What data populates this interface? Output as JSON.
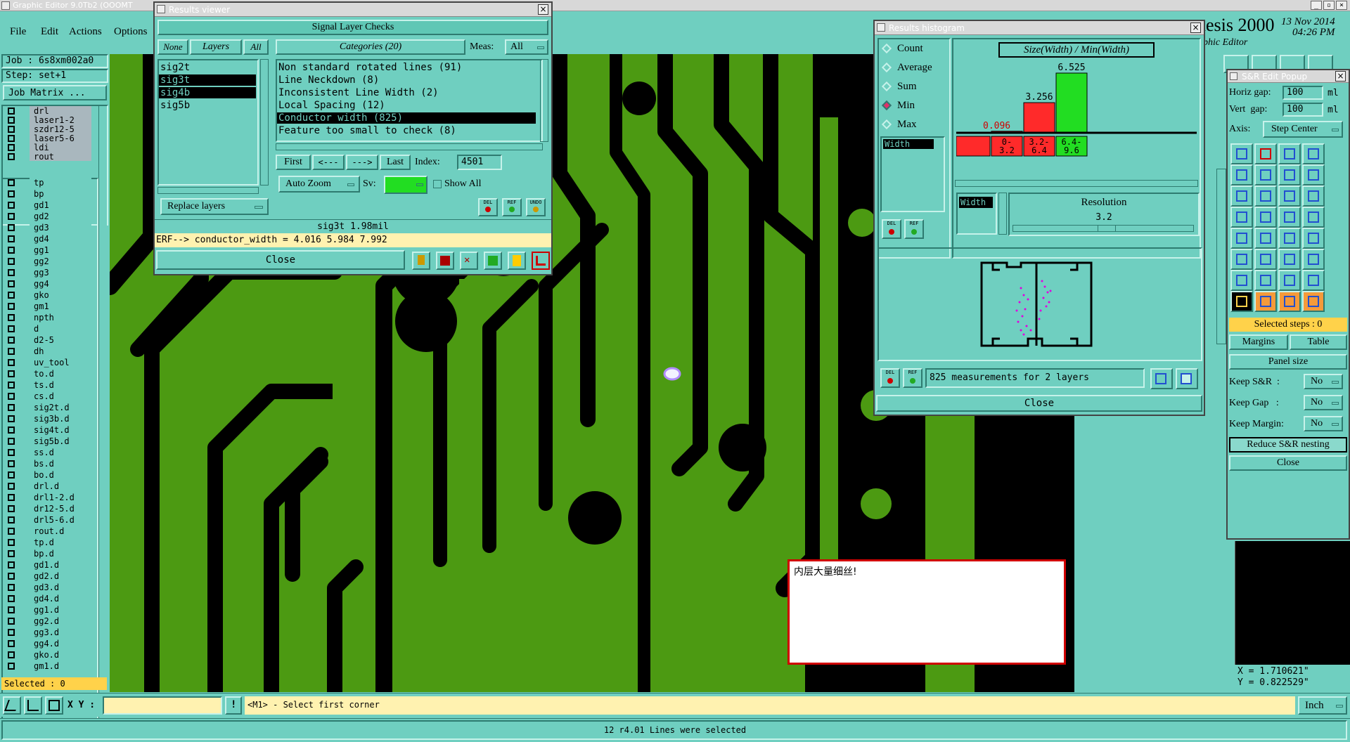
{
  "app": {
    "title": "Graphic Editor 9.0Tb2 (OOOMT",
    "menu": [
      "File",
      "Edit",
      "Actions",
      "Options"
    ],
    "job_label": "Job : 6s8xm002a0",
    "step_label": "Step: set+1",
    "job_matrix_button": "Job Matrix ...",
    "brand_text": "nesis 2000",
    "brand_sub": "aphic Editor",
    "date": "13 Nov 2014",
    "time": "04:26 PM",
    "selected_count": "Selected : 0"
  },
  "layers_top": [
    "drl",
    "laser1-2",
    "szdr12-5",
    "laser5-6",
    "ldi",
    "rout"
  ],
  "layers_main": [
    "tp",
    "bp",
    "gd1",
    "gd2",
    "gd3",
    "gd4",
    "gg1",
    "gg2",
    "gg3",
    "gg4",
    "gko",
    "gm1",
    "npth",
    "d",
    "d2-5",
    "dh",
    "uv_tool",
    "to.d",
    "ts.d",
    "cs.d",
    "sig2t.d",
    "sig3b.d",
    "sig4t.d",
    "sig5b.d",
    "ss.d",
    "bs.d",
    "bo.d",
    "drl.d",
    "drl1-2.d",
    "dr12-5.d",
    "drl5-6.d",
    "rout.d",
    "tp.d",
    "bp.d",
    "gd1.d",
    "gd2.d",
    "gd3.d",
    "gd4.d",
    "gg1.d",
    "gg2.d",
    "gg3.d",
    "gg4.d",
    "gko.d",
    "gm1.d"
  ],
  "results_viewer": {
    "title": "Results viewer",
    "header": "Signal Layer Checks",
    "none_btn": "None",
    "layers_btn": "Layers",
    "all_btn": "All",
    "layers": [
      {
        "name": "sig2t",
        "selected": false
      },
      {
        "name": "sig3t",
        "selected": true
      },
      {
        "name": "sig4b",
        "selected": true
      },
      {
        "name": "sig5b",
        "selected": false
      }
    ],
    "categories_btn": "Categories (20)",
    "meas_label": "Meas:",
    "meas_value": "All",
    "categories": [
      {
        "text": "Non standard rotated lines (91)",
        "selected": false
      },
      {
        "text": "Line Neckdown (8)",
        "selected": false
      },
      {
        "text": "Inconsistent Line Width (2)",
        "selected": false
      },
      {
        "text": "Local Spacing (12)",
        "selected": false
      },
      {
        "text": "Conductor width (825)",
        "selected": true
      },
      {
        "text": "Feature too small to check (8)",
        "selected": false
      }
    ],
    "first_btn": "First",
    "prev_btn": "<---",
    "next_btn": "--->",
    "last_btn": "Last",
    "index_label": "Index:",
    "index_value": "4501",
    "auto_zoom": "Auto Zoom",
    "sv_label": "Sv:",
    "show_all": "Show All",
    "replace_layers": "Replace layers",
    "del_btn": "DEL",
    "ref_btn": "REF",
    "undo_btn": "UNDO",
    "status": "sig3t 1.98mil",
    "erf_line": "ERF--> conductor_width = 4.016 5.984 7.992",
    "close_btn": "Close"
  },
  "histogram": {
    "title": "Results histogram",
    "modes": [
      {
        "label": "Count",
        "checked": false
      },
      {
        "label": "Average",
        "checked": false
      },
      {
        "label": "Sum",
        "checked": false
      },
      {
        "label": "Min",
        "checked": true
      },
      {
        "label": "Max",
        "checked": false
      }
    ],
    "list_item": "Width",
    "chart_label": "Size(Width) / Min(Width)",
    "resolution_label": "Resolution",
    "resolution_value": "3.2",
    "width_label": "Width",
    "summary": "825 measurements for 2 layers",
    "close_btn": "Close",
    "del_btn": "DEL",
    "ref_btn": "REF"
  },
  "chart_data": {
    "type": "bar",
    "title": "Size(Width) / Min(Width)",
    "categories": [
      "0- 3.2",
      "3.2- 6.4",
      "6.4- 9.6"
    ],
    "values": [
      0.096,
      3.256,
      6.525
    ],
    "value_labels": [
      "0.096",
      "3.256",
      "6.525"
    ],
    "colors": [
      "#ff2a2a",
      "#ff2a2a",
      "#22dd22"
    ],
    "ylim": [
      0,
      6.525
    ]
  },
  "sr_popup": {
    "title": "S&R Edit Popup",
    "horiz_gap_label": "Horiz gap:",
    "horiz_gap_value": "100",
    "vert_gap_label": "Vert  gap:",
    "vert_gap_value": "100",
    "unit": "ml",
    "axis_label": "Axis:",
    "axis_value": "Step Center",
    "selected_steps": "Selected steps : 0",
    "margins_btn": "Margins",
    "table_btn": "Table",
    "panel_size_btn": "Panel size",
    "keep_sr_label": "Keep S&R  :",
    "keep_gap_label": "Keep Gap   :",
    "keep_margin_label": "Keep Margin:",
    "no_value": "No",
    "reduce_btn": "Reduce S&R nesting",
    "close_btn": "Close"
  },
  "message_box": {
    "text": "内层大量细丝!"
  },
  "coords": {
    "x": "X = 1.710621\"",
    "y": "Y = 0.822529\""
  },
  "bottom": {
    "xy_label": "X Y :",
    "xy_value": "",
    "hint": "<M1> - Select first corner",
    "unit": "Inch",
    "status": "12 r4.01 Lines were selected"
  },
  "colors": {
    "panel": "#6fcfc0",
    "pcb_green": "#4c9a12",
    "pcb_black": "#000000",
    "highlight_yellow": "#fff2b0",
    "alert_red": "#d00000"
  }
}
